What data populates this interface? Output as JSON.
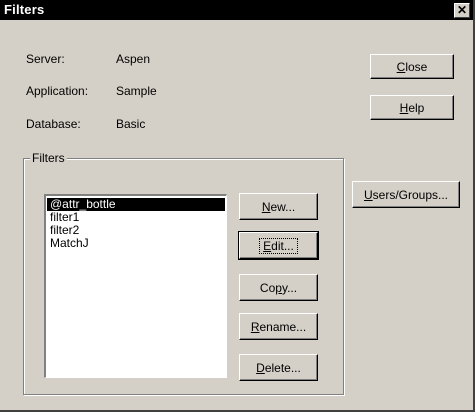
{
  "window": {
    "title": "Filters",
    "close_glyph": "✕"
  },
  "info": {
    "server_label": "Server:",
    "server_value": "Aspen",
    "application_label": "Application:",
    "application_value": "Sample",
    "database_label": "Database:",
    "database_value": "Basic"
  },
  "buttons": {
    "close": {
      "ul": "C",
      "rest": "lose"
    },
    "help": {
      "ul": "H",
      "rest": "elp"
    },
    "users_groups": {
      "ul": "U",
      "rest": "sers/Groups..."
    },
    "new": {
      "ul": "N",
      "rest": "ew..."
    },
    "edit": {
      "ul": "E",
      "rest": "dit..."
    },
    "copy": {
      "pre": "Co",
      "ul": "p",
      "rest": "y..."
    },
    "rename": {
      "ul": "R",
      "rest": "ename..."
    },
    "delete": {
      "ul": "D",
      "rest": "elete..."
    }
  },
  "filters_group": {
    "label": "Filters",
    "items": [
      "@attr_bottle",
      "filter1",
      "filter2",
      "MatchJ"
    ],
    "selected": "@attr_bottle"
  }
}
